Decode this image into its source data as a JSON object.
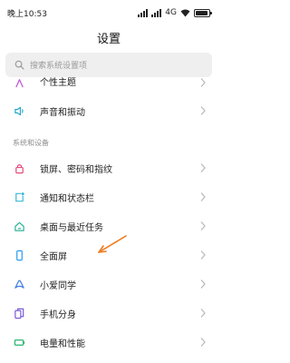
{
  "status": {
    "time": "晚上10:53",
    "network": "4G",
    "battery_level": 0.9
  },
  "header": {
    "title": "设置"
  },
  "search": {
    "placeholder": "搜索系统设置项"
  },
  "top_items": [
    {
      "label": "个性主题",
      "icon": "palette-icon"
    },
    {
      "label": "声音和振动",
      "icon": "speaker-icon"
    }
  ],
  "section": {
    "title": "系统和设备"
  },
  "items": [
    {
      "label": "锁屏、密码和指纹",
      "icon": "lock-icon",
      "color": "#e84a7a"
    },
    {
      "label": "通知和状态栏",
      "icon": "notification-icon",
      "color": "#3bb8d6"
    },
    {
      "label": "桌面与最近任务",
      "icon": "home-icon",
      "color": "#2fb29a"
    },
    {
      "label": "全面屏",
      "icon": "phone-icon",
      "color": "#2d9bf0"
    },
    {
      "label": "小爱同学",
      "icon": "assistant-icon",
      "color": "#3a7de0"
    },
    {
      "label": "手机分身",
      "icon": "clone-icon",
      "color": "#7c5cd6"
    },
    {
      "label": "电量和性能",
      "icon": "battery-icon",
      "color": "#27b36b"
    }
  ],
  "colors": {
    "accent_arrow": "#f07b1e",
    "chevron": "#b8b8b8",
    "section_text": "#8e8e8e"
  }
}
